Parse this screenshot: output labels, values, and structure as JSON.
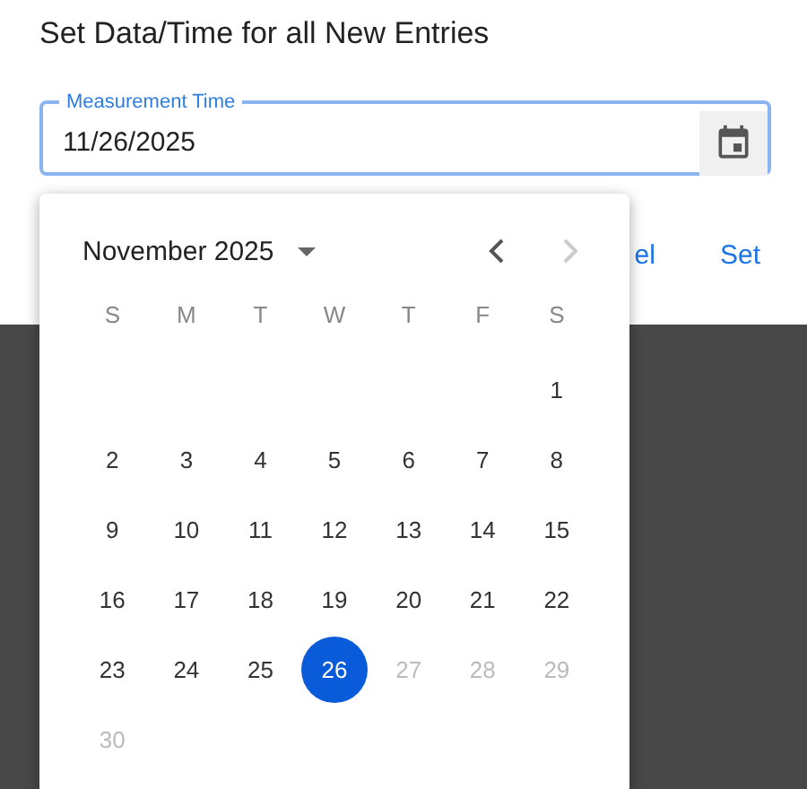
{
  "dialog": {
    "title": "Set Data/Time for all New Entries",
    "field": {
      "label": "Measurement Time",
      "value": "11/26/2025"
    },
    "buttons": [
      {
        "label": "el",
        "kind": "cancel"
      },
      {
        "label": "Set",
        "kind": "set"
      }
    ]
  },
  "calendar": {
    "month": "November 2025",
    "prev_disabled": false,
    "next_disabled": true,
    "weekdays": [
      "S",
      "M",
      "T",
      "W",
      "T",
      "F",
      "S"
    ],
    "weeks": [
      {
        "days": [
          {
            "day": "1",
            "selected": false,
            "disabled": false
          }
        ]
      },
      {
        "days": [
          {
            "day": "2",
            "selected": false,
            "disabled": false
          },
          {
            "day": "3",
            "selected": false,
            "disabled": false
          },
          {
            "day": "4",
            "selected": false,
            "disabled": false
          },
          {
            "day": "5",
            "selected": false,
            "disabled": false
          },
          {
            "day": "6",
            "selected": false,
            "disabled": false
          },
          {
            "day": "7",
            "selected": false,
            "disabled": false
          },
          {
            "day": "8",
            "selected": false,
            "disabled": false
          }
        ]
      },
      {
        "days": [
          {
            "day": "9",
            "selected": false,
            "disabled": false
          },
          {
            "day": "10",
            "selected": false,
            "disabled": false
          },
          {
            "day": "11",
            "selected": false,
            "disabled": false
          },
          {
            "day": "12",
            "selected": false,
            "disabled": false
          },
          {
            "day": "13",
            "selected": false,
            "disabled": false
          },
          {
            "day": "14",
            "selected": false,
            "disabled": false
          },
          {
            "day": "15",
            "selected": false,
            "disabled": false
          }
        ]
      },
      {
        "days": [
          {
            "day": "16",
            "selected": false,
            "disabled": false
          },
          {
            "day": "17",
            "selected": false,
            "disabled": false
          },
          {
            "day": "18",
            "selected": false,
            "disabled": false
          },
          {
            "day": "19",
            "selected": false,
            "disabled": false
          },
          {
            "day": "20",
            "selected": false,
            "disabled": false
          },
          {
            "day": "21",
            "selected": false,
            "disabled": false
          },
          {
            "day": "22",
            "selected": false,
            "disabled": false
          }
        ]
      },
      {
        "days": [
          {
            "day": "23",
            "selected": false,
            "disabled": false
          },
          {
            "day": "24",
            "selected": false,
            "disabled": false
          },
          {
            "day": "25",
            "selected": false,
            "disabled": false
          },
          {
            "day": "26",
            "selected": true,
            "disabled": false
          },
          {
            "day": "27",
            "selected": false,
            "disabled": true
          },
          {
            "day": "28",
            "selected": false,
            "disabled": true
          },
          {
            "day": "29",
            "selected": false,
            "disabled": true
          }
        ]
      },
      {
        "days": [
          {
            "day": "30",
            "selected": false,
            "disabled": true
          }
        ]
      }
    ]
  }
}
